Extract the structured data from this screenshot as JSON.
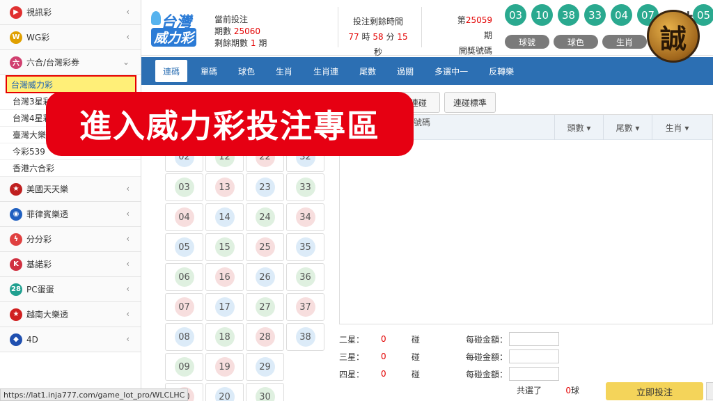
{
  "sidebar": {
    "items": [
      {
        "label": "視訊彩",
        "icon": "play-icon",
        "color": "#e03030",
        "glyph": "▶"
      },
      {
        "label": "WG彩",
        "icon": "wg-icon",
        "color": "#e0a000",
        "glyph": "W"
      },
      {
        "label": "六合/台灣彩券",
        "icon": "six-icon",
        "color": "#d04070",
        "glyph": "六",
        "expanded": true
      }
    ],
    "sub_items": [
      {
        "label": "台灣威力彩",
        "active": true
      },
      {
        "label": "台灣3星彩"
      },
      {
        "label": "台灣4星彩"
      },
      {
        "label": "臺灣大樂透"
      },
      {
        "label": "今彩539"
      },
      {
        "label": "香港六合彩"
      }
    ],
    "items2": [
      {
        "label": "美國天天樂",
        "icon": "star-icon",
        "color": "#c02020",
        "glyph": "★"
      },
      {
        "label": "菲律賓樂透",
        "icon": "swirl-icon",
        "color": "#2060c0",
        "glyph": "◉"
      },
      {
        "label": "分分彩",
        "icon": "bolt-icon",
        "color": "#e04040",
        "glyph": "ϟ"
      },
      {
        "label": "基諾彩",
        "icon": "k-icon",
        "color": "#d03040",
        "glyph": "K"
      },
      {
        "label": "PC蛋蛋",
        "icon": "28-icon",
        "color": "#20a090",
        "glyph": "28"
      },
      {
        "label": "越南大樂透",
        "icon": "vn-star-icon",
        "color": "#d02020",
        "glyph": "★"
      },
      {
        "label": "4D",
        "icon": "4d-icon",
        "color": "#2050b0",
        "glyph": "◆"
      }
    ],
    "chevron": "‹",
    "chevron_down": "⌄"
  },
  "header": {
    "logo_top": "台灣",
    "logo_bottom": "威力彩",
    "current_label": "當前投注",
    "period_label": "期數",
    "period_value": "25060",
    "remaining_label": "剩餘期數",
    "remaining_value": "1",
    "remaining_unit": "期",
    "time_title": "投注剩餘時間",
    "hours": "77",
    "hours_unit": "時",
    "minutes": "58",
    "minutes_unit": "分",
    "seconds": "15",
    "seconds_unit": "秒",
    "draw_prefix": "第",
    "draw_no": "25059",
    "draw_suffix": "期",
    "draw_label": "開獎號碼",
    "balls": [
      "03",
      "10",
      "38",
      "33",
      "04",
      "07"
    ],
    "plus": "+",
    "special_ball": "05",
    "pills": [
      "球號",
      "球色",
      "生肖"
    ],
    "seal_char": "誠"
  },
  "tabs": [
    "連碼",
    "單碼",
    "球色",
    "生肖",
    "生肖連",
    "尾數",
    "過關",
    "多選中一",
    "反轉樂"
  ],
  "subtabs": {
    "a": "",
    "b": "",
    "c": "",
    "d": "碰連碰",
    "e": "連碰標準"
  },
  "panel": {
    "label": "號碼",
    "columns": [
      "頭數 ▾",
      "尾數 ▾",
      "生肖 ▾"
    ]
  },
  "numbers": [
    [
      "02",
      "12",
      "22",
      "32"
    ],
    [
      "03",
      "13",
      "23",
      "33"
    ],
    [
      "04",
      "14",
      "24",
      "34"
    ],
    [
      "05",
      "15",
      "25",
      "35"
    ],
    [
      "06",
      "16",
      "26",
      "36"
    ],
    [
      "07",
      "17",
      "27",
      "37"
    ],
    [
      "08",
      "18",
      "28",
      "38"
    ],
    [
      "09",
      "19",
      "29",
      ""
    ],
    [
      "10",
      "20",
      "30",
      ""
    ]
  ],
  "summary": [
    {
      "k": "二星：",
      "v": "0",
      "c": "碰",
      "m": "每碰金額："
    },
    {
      "k": "三星：",
      "v": "0",
      "c": "碰",
      "m": "每碰金額："
    },
    {
      "k": "四星：",
      "v": "0",
      "c": "碰",
      "m": "每碰金額："
    }
  ],
  "total_label": "共選了",
  "total_value": "0",
  "total_unit": "球",
  "submit": "立即投注",
  "banner": "進入威力彩投注專區",
  "url": "https://lat1.inja777.com/game_lot_pro/WLCLHC"
}
